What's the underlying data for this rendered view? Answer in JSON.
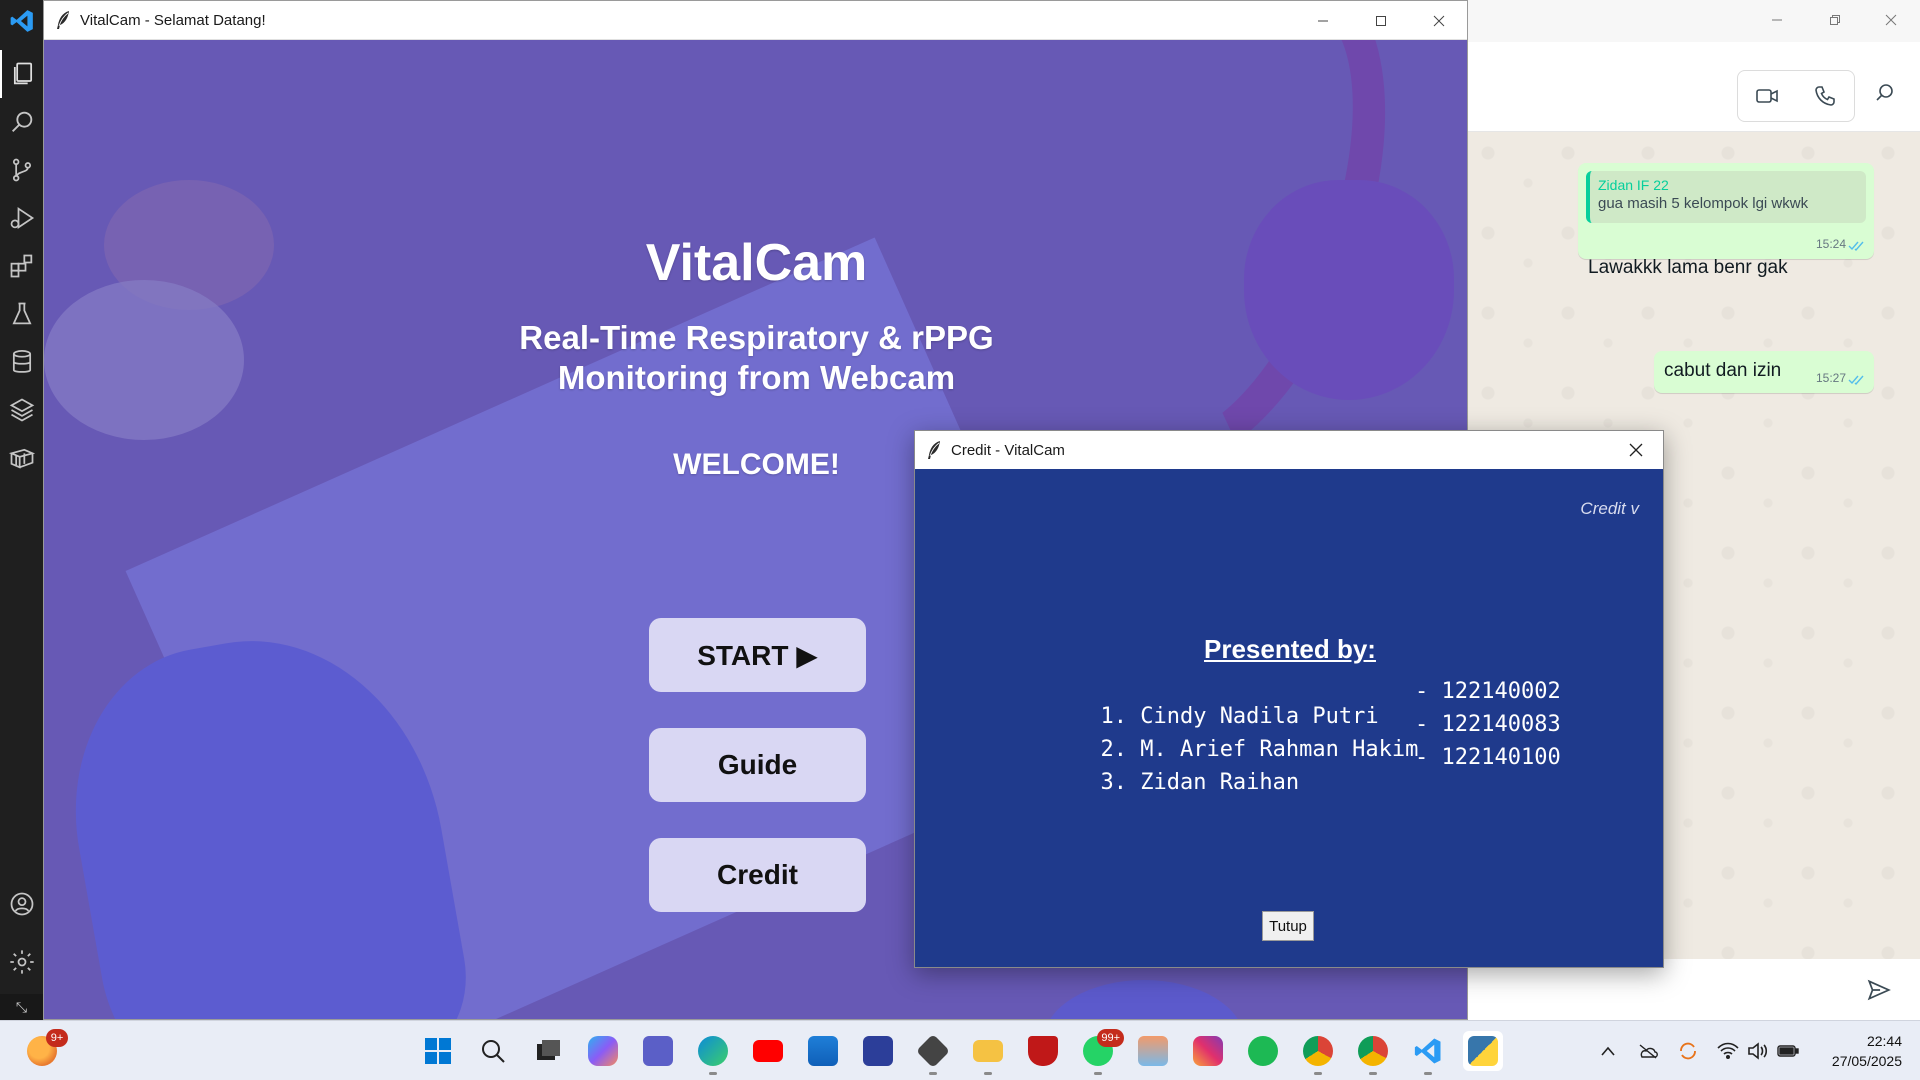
{
  "vscode": {
    "activity_items": [
      "explorer-icon",
      "search-icon",
      "source-control-icon",
      "run-debug-icon",
      "extensions-icon",
      "testing-icon",
      "database-icon",
      "layers-icon",
      "package-icon"
    ],
    "bottom_items": [
      "account-icon",
      "settings-icon"
    ]
  },
  "vitalcam": {
    "window_title": "VitalCam - Selamat Datang!",
    "title": "VitalCam",
    "subtitle_line1": "Real-Time Respiratory & rPPG",
    "subtitle_line2": "Monitoring from Webcam",
    "welcome": "WELCOME!",
    "start_label": "START ▶",
    "guide_label": "Guide",
    "credit_label": "Credit"
  },
  "credit_dialog": {
    "window_title": "Credit - VitalCam",
    "marquee": "Credit v",
    "heading": "Presented by:",
    "members": [
      {
        "label": "1. Cindy Nadila Putri",
        "nim": "- 122140002"
      },
      {
        "label": "2. M. Arief Rahman Hakim",
        "nim": "- 122140083"
      },
      {
        "label": "3. Zidan Raihan",
        "nim": "- 122140100"
      }
    ],
    "close_label": "Tutup"
  },
  "whatsapp": {
    "messages": [
      {
        "quote_name": "Zidan IF 22",
        "quote_text": "gua masih 5 kelompok lgi wkwk",
        "text": "Lawakkk lama benr gak",
        "time": "15:24"
      },
      {
        "text": "cabut dan izin",
        "time": "15:27"
      }
    ]
  },
  "taskbar": {
    "weather_badge": "9+",
    "whatsapp_badge": "99+",
    "time": "22:44",
    "date": "27/05/2025"
  },
  "colors": {
    "vitalcam_bg": "#6b5cae",
    "credit_bg": "#1f3a8c",
    "bubble_green": "#d9fdd3",
    "accent_blue": "#0067c0"
  }
}
